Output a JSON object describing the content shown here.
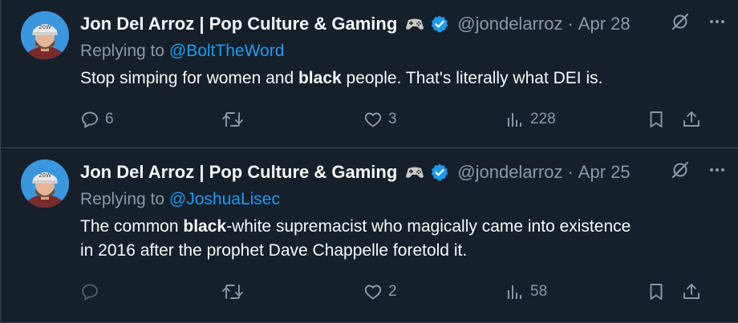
{
  "tweets": [
    {
      "display_name": "Jon Del Arroz | Pop Culture & Gaming",
      "handle": "@jondelarroz",
      "separator": "·",
      "date": "Apr 28",
      "reply_prefix": "Replying to ",
      "reply_mention": "@BoltTheWord",
      "text_parts": [
        "Stop simping for women and ",
        "black",
        " people. That's literally what DEI is."
      ],
      "text_line2": "",
      "replies": "6",
      "reposts": "",
      "likes": "3",
      "views": "228"
    },
    {
      "display_name": "Jon Del Arroz | Pop Culture & Gaming",
      "handle": "@jondelarroz",
      "separator": "·",
      "date": "Apr 25",
      "reply_prefix": "Replying to ",
      "reply_mention": "@JoshuaLisec",
      "text_parts": [
        "The common ",
        "black",
        "-white supremacist who magically came into existence"
      ],
      "text_line2": "in 2016 after the prophet Dave Chappelle foretold it.",
      "replies": "",
      "reposts": "",
      "likes": "2",
      "views": "58"
    }
  ],
  "colors": {
    "background": "#15202b",
    "text": "#f7f9f9",
    "muted": "#8b98a5",
    "accent": "#1d9bf0",
    "border": "#38444d"
  },
  "icons": {
    "gamepad": "gamepad-icon",
    "verified": "verified-badge-icon",
    "grok": "grok-icon",
    "more": "more-icon",
    "reply": "reply-icon",
    "repost": "repost-icon",
    "like": "like-icon",
    "views": "views-icon",
    "bookmark": "bookmark-icon",
    "share": "share-icon"
  }
}
